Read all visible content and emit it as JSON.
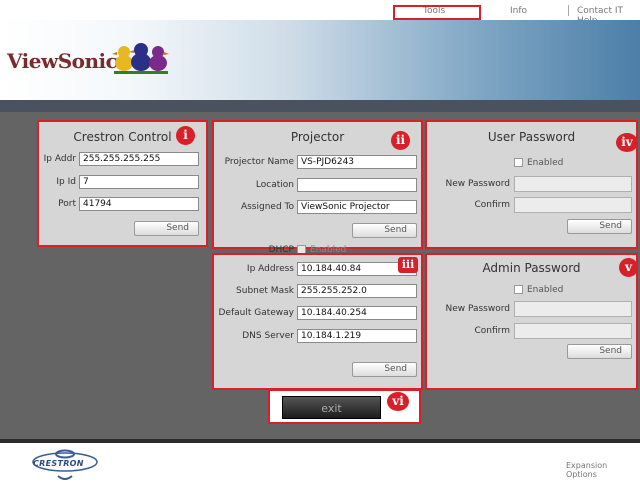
{
  "topnav": {
    "tools": "Tools",
    "info": "Info",
    "contact": "Contact IT Help"
  },
  "brand": {
    "logo_text": "ViewSonic"
  },
  "crestron": {
    "title": "Crestron Control",
    "badge": "i",
    "ip_addr_label": "Ip Addr",
    "ip_addr_value": "255.255.255.255",
    "ip_id_label": "Ip Id",
    "ip_id_value": "7",
    "port_label": "Port",
    "port_value": "41794",
    "send_label": "Send"
  },
  "projector": {
    "title": "Projector",
    "badge": "ii",
    "name_label": "Projector Name",
    "name_value": "VS-PJD6243",
    "location_label": "Location",
    "location_value": "",
    "assigned_label": "Assigned To",
    "assigned_value": "ViewSonic Projector",
    "send_label": "Send",
    "dhcp_label": "DHCP",
    "dhcp_enabled_label": "Enabled"
  },
  "network": {
    "badge": "iii",
    "ip_label": "Ip Address",
    "ip_value": "10.184.40.84",
    "subnet_label": "Subnet Mask",
    "subnet_value": "255.255.252.0",
    "gateway_label": "Default Gateway",
    "gateway_value": "10.184.40.254",
    "dns_label": "DNS Server",
    "dns_value": "10.184.1.219",
    "send_label": "Send"
  },
  "user_password": {
    "title": "User Password",
    "badge": "iv",
    "enabled_label": "Enabled",
    "new_label": "New Password",
    "confirm_label": "Confirm",
    "send_label": "Send"
  },
  "admin_password": {
    "title": "Admin Password",
    "badge": "v",
    "enabled_label": "Enabled",
    "new_label": "New Password",
    "confirm_label": "Confirm",
    "send_label": "Send"
  },
  "exit": {
    "label": "exit",
    "badge": "vi"
  },
  "footer": {
    "brand": "CRESTRON",
    "expansion": "Expansion Options"
  }
}
